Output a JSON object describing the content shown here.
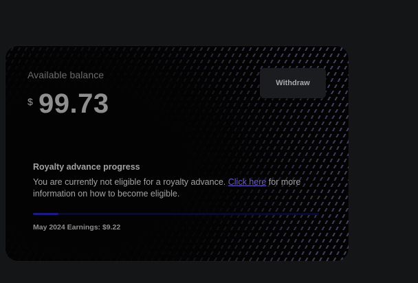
{
  "balance": {
    "label": "Available balance",
    "currency_symbol": "$",
    "amount": "99.73"
  },
  "actions": {
    "withdraw_label": "Withdraw"
  },
  "royalty": {
    "title": "Royalty advance progress",
    "text_before_link": "You are currently not eligible for a royalty advance. ",
    "link_text": "Click here",
    "text_after_link": " for more information on how to become eligible.",
    "progress_fraction": 0.09
  },
  "earnings": {
    "text": "May 2024 Earnings: $9.22"
  },
  "colors": {
    "background": "#131516",
    "card": "#030303",
    "accent": "#6b5cc4",
    "progress_fill": "#1d1985"
  }
}
